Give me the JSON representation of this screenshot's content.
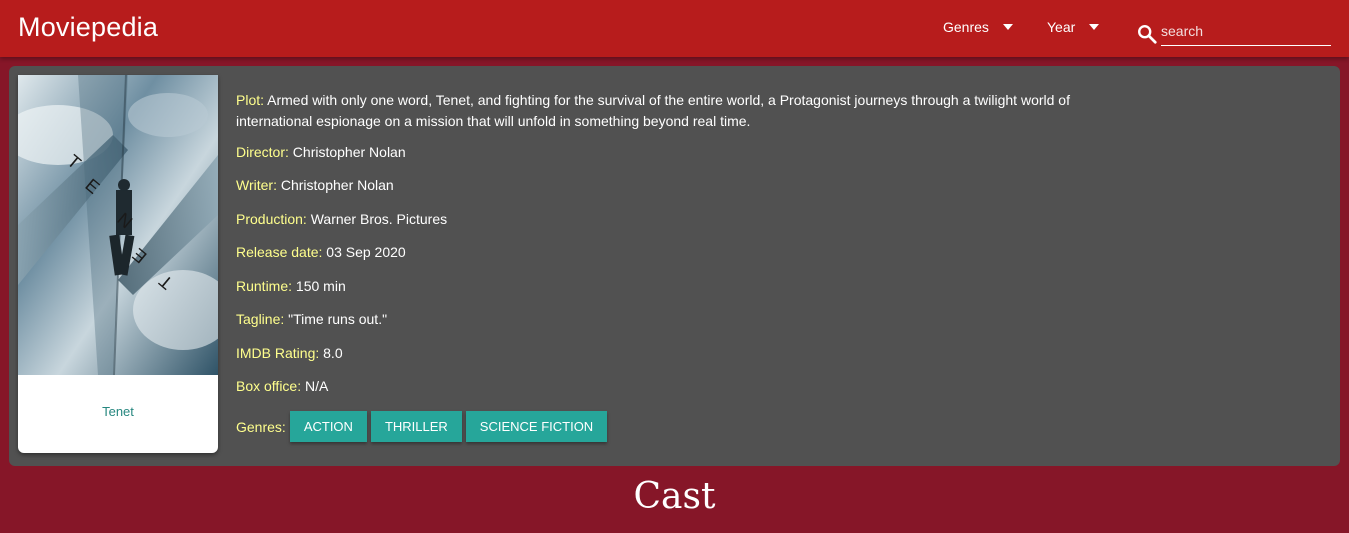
{
  "navbar": {
    "brand": "Moviepedia",
    "genres_label": "Genres",
    "year_label": "Year",
    "search_placeholder": "search",
    "icons": [
      "chevron-down-icon",
      "search-icon"
    ]
  },
  "movie": {
    "poster_caption": "Tenet",
    "poster_title_letters": "TENET",
    "plot_label": "Plot:",
    "plot": "Armed with only one word, Tenet, and fighting for the survival of the entire world, a Protagonist journeys through a twilight world of international espionage on a mission that will unfold in something beyond real time.",
    "director_label": "Director:",
    "director": "Christopher Nolan",
    "writer_label": "Writer:",
    "writer": "Christopher Nolan",
    "production_label": "Production:",
    "production": "Warner Bros. Pictures",
    "release_label": "Release date:",
    "release_date": "03 Sep 2020",
    "runtime_label": "Runtime:",
    "runtime": "150 min",
    "tagline_label": "Tagline:",
    "tagline": "\"Time runs out.\"",
    "rating_label": "IMDB Rating:",
    "rating": "8.0",
    "box_office_label": "Box office:",
    "box_office": "N/A",
    "genres_label": "Genres:",
    "genres": [
      "ACTION",
      "THRILLER",
      "SCIENCE FICTION"
    ]
  },
  "cast_heading": "Cast",
  "colors": {
    "navbar": "#b71c1c",
    "page_background": "#861628",
    "panel": "#515151",
    "label": "#ffff8d",
    "chip": "#26a69a"
  }
}
